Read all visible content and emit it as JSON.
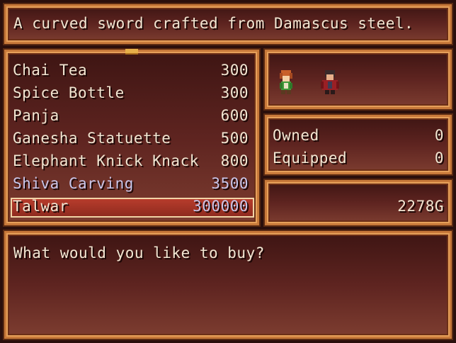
{
  "help": {
    "text": "A curved sword crafted from Damascus steel."
  },
  "shop": {
    "items": [
      {
        "name": "Chai Tea",
        "price": "300"
      },
      {
        "name": "Spice Bottle",
        "price": "300"
      },
      {
        "name": "Panja",
        "price": "600"
      },
      {
        "name": "Ganesha Statuette",
        "price": "500"
      },
      {
        "name": "Elephant Knick Knack",
        "price": "800"
      },
      {
        "name": "Shiva Carving",
        "price": "3500"
      },
      {
        "name": "Talwar",
        "price": "300000"
      }
    ]
  },
  "status": {
    "owned_label": "Owned",
    "owned_value": "0",
    "equipped_label": "Equipped",
    "equipped_value": "0"
  },
  "gold": {
    "value": "2278G"
  },
  "message": {
    "text": "What would you like to buy?"
  },
  "party": {
    "actors": [
      "green-haired-hero",
      "red-cloaked-warrior"
    ]
  },
  "colors": {
    "frame": "#c8793a",
    "window_top": "#3e1513",
    "window_bottom": "#7d3d30",
    "cursor": "#b73c2c",
    "text": "#f2e6d2",
    "disabled_text": "#c9c6ea"
  }
}
